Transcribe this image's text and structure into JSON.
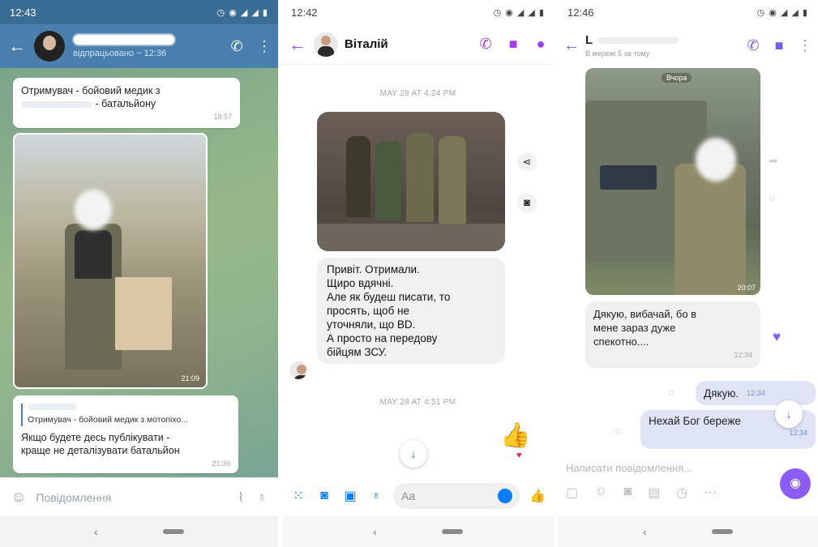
{
  "telegram": {
    "status_time": "12:43",
    "contact_status": "відпрацьовано ~ 12:36",
    "msg1": {
      "line1": "Отримувач - бойовий медик з",
      "line2": "- батальйону",
      "time": "18:57"
    },
    "photo_time": "21:09",
    "msg2": {
      "reply_quote": "Отримувач - бойовий медик з мотопіхо...",
      "text_line1": "Якщо будете десь публікувати -",
      "text_line2": "краще не деталізувати батальйон",
      "time": "21:39"
    },
    "input_placeholder": "Повідомлення"
  },
  "messenger": {
    "status_time": "12:42",
    "contact_name": "Віталій",
    "date1": "MAY 28 AT 4:24 PM",
    "message_lines": [
      "Привіт. Отримали.",
      "Щиро вдячні.",
      "Але як будеш писати, то",
      "просять, щоб не",
      "уточняли, що ВD.",
      "А просто на передову",
      "бійцям ЗСУ."
    ],
    "date2": "MAY 28 AT 4:51 PM",
    "input_placeholder": "Aa"
  },
  "viber": {
    "status_time": "12:46",
    "contact_initial": "L",
    "contact_status": "В мережі 5 хв тому",
    "photo_caption": "Вчора",
    "photo_time": "20:07",
    "msg_in_lines": [
      "Дякую, вибачай, бо в",
      "мене зараз дуже",
      "спекотно...."
    ],
    "msg_in_time": "12:34",
    "out1": {
      "text": "Дякую.",
      "time": "12:34"
    },
    "out2": {
      "text": "Нехай Бог береже",
      "time": "12:34"
    },
    "input_placeholder": "Написати повідомлення..."
  },
  "colors": {
    "telegram_header": "#4a7fad",
    "messenger_accent": "#a43cf0",
    "messenger_blue": "#0a7cff",
    "viber_accent": "#7360f2"
  }
}
